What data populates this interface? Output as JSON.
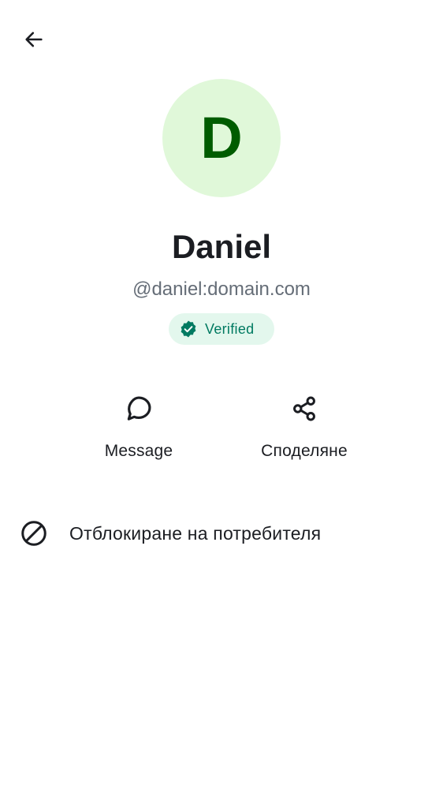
{
  "header": {
    "back_icon": "arrow-left-icon"
  },
  "profile": {
    "avatar_letter": "D",
    "avatar_bg": "#e0f8d9",
    "avatar_fg": "#005c00",
    "display_name": "Daniel",
    "user_id": "@daniel:domain.com",
    "verified_label": "Verified",
    "verified_icon": "verified-shield-icon",
    "verified_color": "#007a61"
  },
  "actions": {
    "message": {
      "label": "Message",
      "icon": "chat-bubble-icon"
    },
    "share": {
      "label": "Споделяне",
      "icon": "share-icon"
    }
  },
  "options": {
    "block": {
      "label": "Отблокиране на потребителя",
      "icon": "block-icon"
    }
  }
}
